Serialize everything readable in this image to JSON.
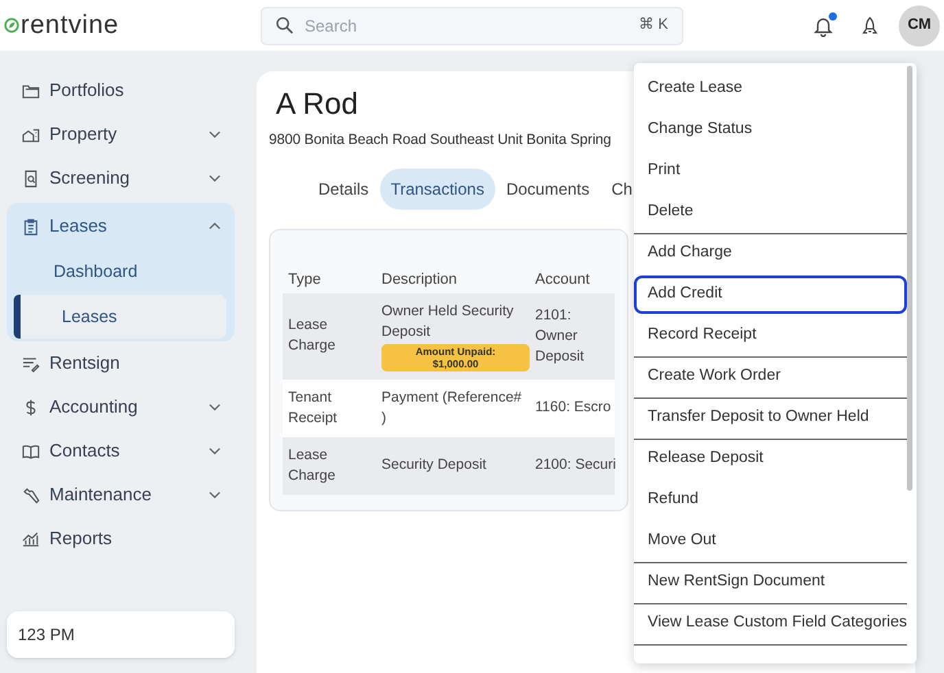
{
  "header": {
    "logo": "rentvine",
    "search": {
      "placeholder": "Search",
      "shortcut": "⌘ K"
    },
    "notifications_unread": true,
    "avatar": "CM"
  },
  "sidebar": {
    "items": [
      {
        "label": "Portfolios",
        "kind": "link"
      },
      {
        "label": "Property",
        "kind": "group",
        "expanded": false
      },
      {
        "label": "Screening",
        "kind": "group",
        "expanded": false
      },
      {
        "label": "Leases",
        "kind": "group",
        "expanded": true,
        "children": [
          {
            "label": "Dashboard",
            "selected": false
          },
          {
            "label": "Leases",
            "selected": true
          }
        ]
      },
      {
        "label": "Rentsign",
        "kind": "link"
      },
      {
        "label": "Accounting",
        "kind": "group",
        "expanded": false
      },
      {
        "label": "Contacts",
        "kind": "group",
        "expanded": false
      },
      {
        "label": "Maintenance",
        "kind": "group",
        "expanded": false
      },
      {
        "label": "Reports",
        "kind": "link"
      }
    ],
    "footer": "123 PM"
  },
  "lease": {
    "title": "A Rod",
    "address": "9800 Bonita Beach Road Southeast Unit Bonita Spring",
    "tabs": [
      {
        "label": "Details",
        "selected": false
      },
      {
        "label": "Transactions",
        "selected": true
      },
      {
        "label": "Documents",
        "selected": false
      },
      {
        "label": "Ch",
        "selected": false
      }
    ],
    "table": {
      "columns": [
        "Type",
        "Description",
        "Account"
      ],
      "rows": [
        {
          "cells": [
            "Lease Charge",
            "Owner Held Security Deposit",
            "2101: Owner Deposit"
          ],
          "badge": "Amount Unpaid: $1,000.00"
        },
        {
          "cells": [
            "Tenant Receipt",
            "Payment (Reference# )",
            "1160: Escro"
          ]
        },
        {
          "cells": [
            "Lease Charge",
            "Security Deposit",
            "2100: Securi"
          ]
        }
      ]
    }
  },
  "menu": {
    "items": [
      {
        "label": "Create Lease",
        "selected": false,
        "divider_after": false
      },
      {
        "label": "Change Status",
        "selected": false,
        "divider_after": false
      },
      {
        "label": "Print",
        "selected": false,
        "divider_after": false
      },
      {
        "label": "Delete",
        "selected": false,
        "divider_after": true
      },
      {
        "label": "Add Charge",
        "selected": false,
        "divider_after": false
      },
      {
        "label": "Add Credit",
        "selected": true,
        "divider_after": false
      },
      {
        "label": "Record Receipt",
        "selected": false,
        "divider_after": true
      },
      {
        "label": "Create Work Order",
        "selected": false,
        "divider_after": true
      },
      {
        "label": "Transfer Deposit to Owner Held",
        "selected": false,
        "divider_after": true
      },
      {
        "label": "Release Deposit",
        "selected": false,
        "divider_after": false
      },
      {
        "label": "Refund",
        "selected": false,
        "divider_after": false
      },
      {
        "label": "Move Out",
        "selected": false,
        "divider_after": true
      },
      {
        "label": "New RentSign Document",
        "selected": false,
        "divider_after": true
      },
      {
        "label": "View Lease Custom Field Categories",
        "selected": false,
        "divider_after": true
      }
    ]
  }
}
